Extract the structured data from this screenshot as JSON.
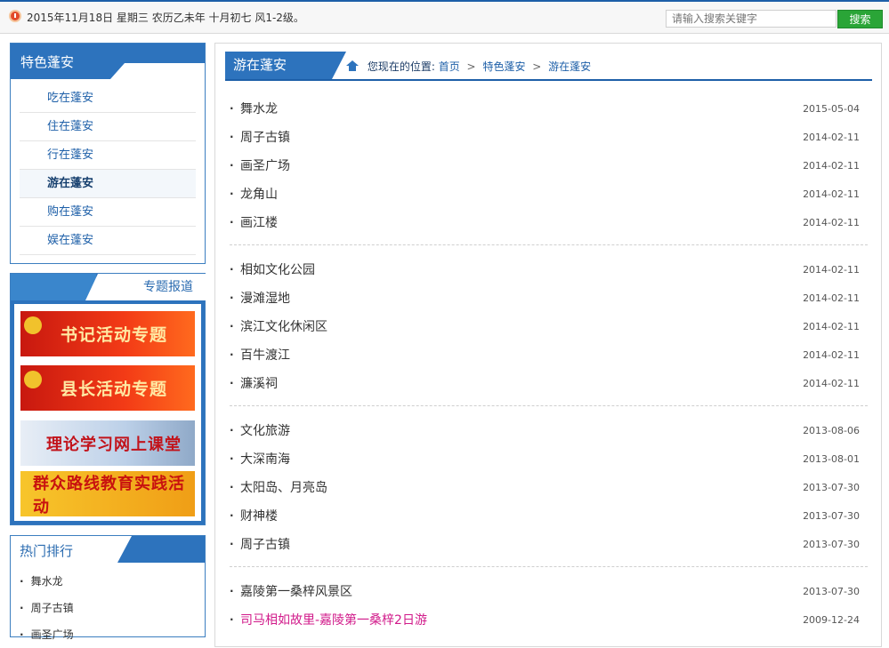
{
  "topbar": {
    "date_text": "2015年11月18日  星期三  农历乙未年  十月初七   风1-2级。",
    "search_placeholder": "请输入搜索关键字",
    "search_button": "搜索"
  },
  "sidebar": {
    "title": "特色蓬安",
    "items": [
      {
        "label": "吃在蓬安"
      },
      {
        "label": "住在蓬安"
      },
      {
        "label": "行在蓬安"
      },
      {
        "label": "游在蓬安"
      },
      {
        "label": "购在蓬安"
      },
      {
        "label": "娱在蓬安"
      }
    ],
    "active_index": 3
  },
  "special": {
    "title": "专题报道",
    "banners": [
      {
        "label": "书记活动专题"
      },
      {
        "label": "县长活动专题"
      },
      {
        "label": "理论学习网上课堂"
      },
      {
        "label": "群众路线教育实践活动"
      }
    ]
  },
  "hot": {
    "title": "热门排行",
    "items": [
      {
        "label": "舞水龙"
      },
      {
        "label": "周子古镇"
      },
      {
        "label": "画圣广场"
      }
    ]
  },
  "main": {
    "tab_title": "游在蓬安",
    "breadcrumb": {
      "prefix": "您现在的位置:",
      "items": [
        "首页",
        "特色蓬安",
        "游在蓬安"
      ]
    },
    "groups": [
      [
        {
          "title": "舞水龙",
          "date": "2015-05-04"
        },
        {
          "title": "周子古镇",
          "date": "2014-02-11"
        },
        {
          "title": "画圣广场",
          "date": "2014-02-11"
        },
        {
          "title": "龙角山",
          "date": "2014-02-11"
        },
        {
          "title": "画江楼",
          "date": "2014-02-11"
        }
      ],
      [
        {
          "title": "相如文化公园",
          "date": "2014-02-11"
        },
        {
          "title": "漫滩湿地",
          "date": "2014-02-11"
        },
        {
          "title": "滨江文化休闲区",
          "date": "2014-02-11"
        },
        {
          "title": "百牛渡江",
          "date": "2014-02-11"
        },
        {
          "title": "濂溪祠",
          "date": "2014-02-11"
        }
      ],
      [
        {
          "title": "文化旅游",
          "date": "2013-08-06"
        },
        {
          "title": "大深南海",
          "date": "2013-08-01"
        },
        {
          "title": "太阳岛、月亮岛",
          "date": "2013-07-30"
        },
        {
          "title": "财神楼",
          "date": "2013-07-30"
        },
        {
          "title": "周子古镇",
          "date": "2013-07-30"
        }
      ],
      [
        {
          "title": "嘉陵第一桑梓风景区",
          "date": "2013-07-30"
        },
        {
          "title": "司马相如故里-嘉陵第一桑梓2日游",
          "date": "2009-12-24",
          "highlight": true
        }
      ]
    ]
  }
}
